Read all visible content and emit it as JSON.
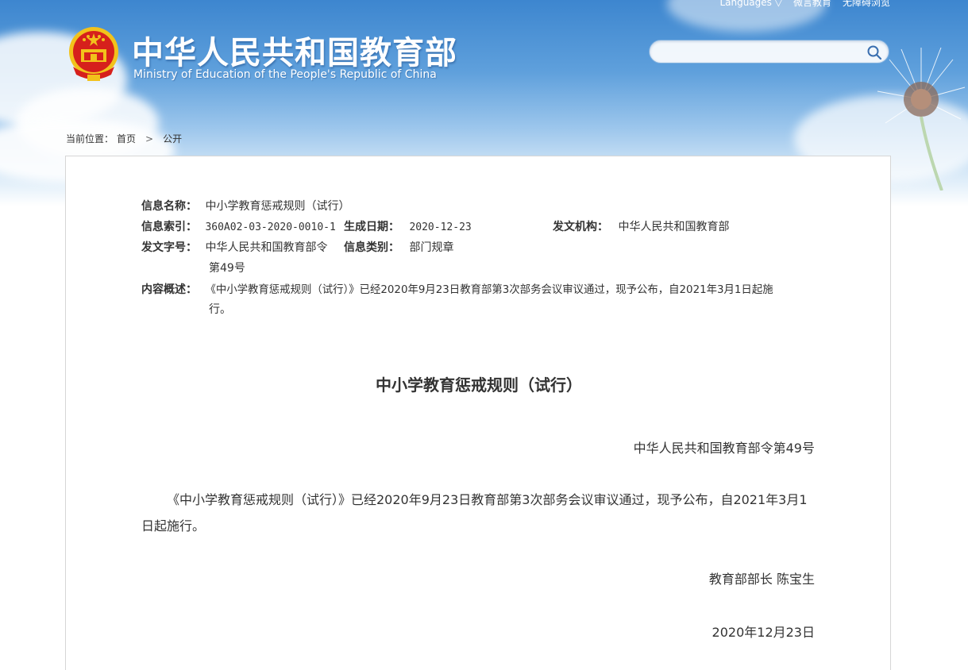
{
  "header": {
    "languages_label": "Languages",
    "link_weixin": "微言教育",
    "link_accessible": "无障碍浏览",
    "site_title": "中华人民共和国教育部",
    "site_subtitle": "Ministry of Education of the People's Republic of China",
    "search_value": ""
  },
  "breadcrumb": {
    "prefix": "当前位置：",
    "home": "首页",
    "current": "公开"
  },
  "meta": {
    "name_label": "信息名称：",
    "name_value": "中小学教育惩戒规则（试行）",
    "index_label": "信息索引：",
    "index_value": "360A02-03-2020-0010-1",
    "date_label": "生成日期：",
    "date_value": "2020-12-23",
    "org_label": "发文机构：",
    "org_value": "中华人民共和国教育部",
    "docno_label": "发文字号：",
    "docno_value_line1": "中华人民共和国教育部令",
    "docno_value_line2": "第49号",
    "type_label": "信息类别：",
    "type_value": "部门规章",
    "summary_label": "内容概述：",
    "summary_line1": "《中小学教育惩戒规则（试行）》已经2020年9月23日教育部第3次部务会议审议通过，现予公布，自2021年3月1日起施",
    "summary_line2": "行。"
  },
  "document": {
    "title": "中小学教育惩戒规则（试行）",
    "number": "中华人民共和国教育部令第49号",
    "body": "《中小学教育惩戒规则（试行）》已经2020年9月23日教育部第3次部务会议审议通过，现予公布，自2021年3月1日起施行。",
    "signature": "教育部部长 陈宝生",
    "date": "2020年12月23日"
  },
  "colors": {
    "header_blue": "#3d86cf",
    "emblem_red": "#d6201c",
    "emblem_gold": "#f2c21b"
  }
}
